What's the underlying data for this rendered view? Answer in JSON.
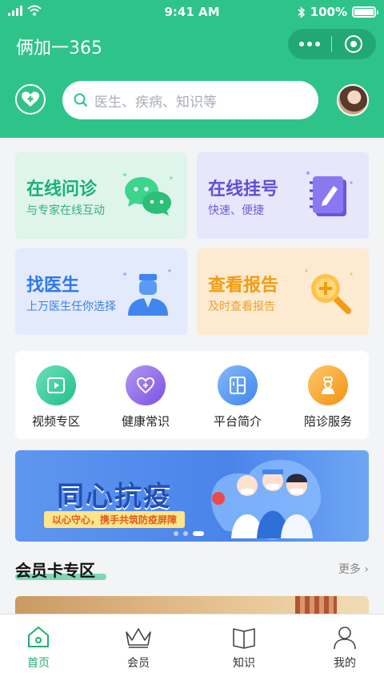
{
  "status_bar": {
    "time": "9:41 AM",
    "battery": "100%",
    "battery_level": 1.0
  },
  "app": {
    "title": "俩加一365"
  },
  "search": {
    "placeholder": "医生、疾病、知识等"
  },
  "cards": [
    {
      "title": "在线问诊",
      "subtitle": "与专家在线互动",
      "icon": "wechat-chat-icon"
    },
    {
      "title": "在线挂号",
      "subtitle": "快速、便捷",
      "icon": "notebook-icon"
    },
    {
      "title": "找医生",
      "subtitle": "上万医生任你选择",
      "icon": "doctor-icon"
    },
    {
      "title": "查看报告",
      "subtitle": "及时查看报告",
      "icon": "magnifier-plus-icon"
    }
  ],
  "quick_actions": [
    {
      "label": "视频专区",
      "icon": "video-icon",
      "color": "#2fc99a"
    },
    {
      "label": "健康常识",
      "icon": "heart-plus-icon",
      "color": "#8b64e8"
    },
    {
      "label": "平台简介",
      "icon": "building-icon",
      "color": "#4a8ff0"
    },
    {
      "label": "陪诊服务",
      "icon": "nurse-icon",
      "color": "#f5a02c"
    }
  ],
  "banner": {
    "title": "同心抗疫",
    "slogan": "以心守心，携手共筑防疫屏障"
  },
  "member_section": {
    "title": "会员卡专区",
    "more": "更多"
  },
  "tabbar": [
    {
      "label": "首页",
      "icon": "home-icon",
      "active": true
    },
    {
      "label": "会员",
      "icon": "crown-icon",
      "active": false
    },
    {
      "label": "知识",
      "icon": "book-icon",
      "active": false
    },
    {
      "label": "我的",
      "icon": "user-icon",
      "active": false
    }
  ],
  "colors": {
    "brand": "#2ec489",
    "active_tab": "#1fae73"
  }
}
